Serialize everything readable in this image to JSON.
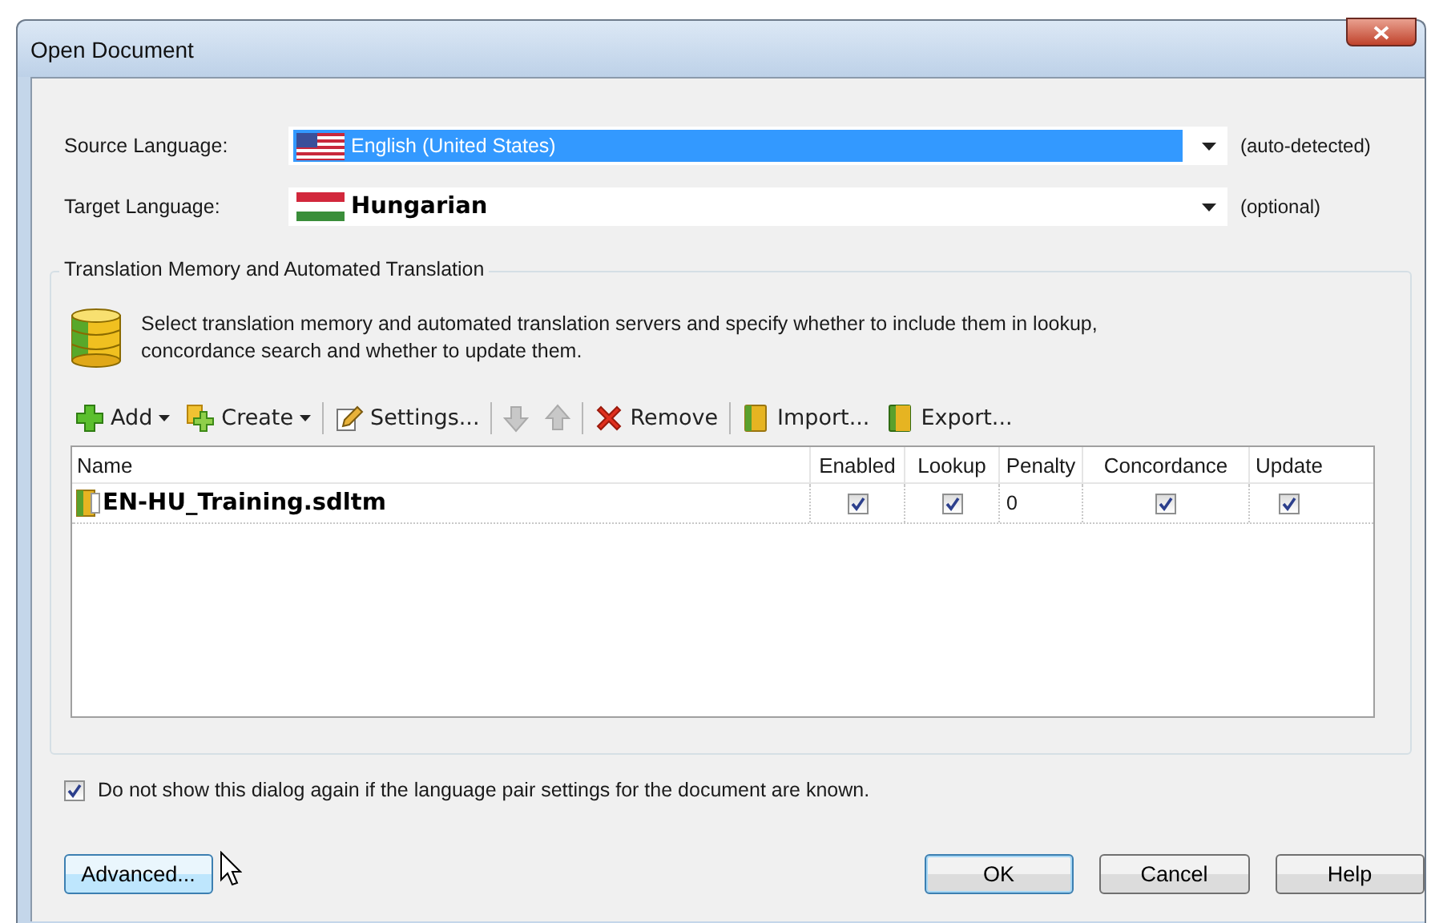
{
  "window": {
    "title": "Open Document"
  },
  "languages": [
    {
      "label": "Source Language:",
      "value": "English (United States)",
      "selected": true,
      "note": "(auto-detected)"
    },
    {
      "label": "Target Language:",
      "value": "Hungarian",
      "selected": false,
      "note": "(optional)"
    }
  ],
  "group": {
    "title": "Translation Memory and Automated Translation",
    "description": "Select translation memory and automated translation servers and specify whether to include them in lookup, concordance search and whether to update them.",
    "toolbar": [
      {
        "kind": "add",
        "label": "Add",
        "disabled": false
      },
      {
        "kind": "create",
        "label": "Create",
        "disabled": false
      },
      {
        "kind": "separator"
      },
      {
        "kind": "settings",
        "label": "Settings...",
        "disabled": false
      },
      {
        "kind": "separator"
      },
      {
        "kind": "down",
        "disabled": true
      },
      {
        "kind": "up",
        "disabled": true
      },
      {
        "kind": "separator"
      },
      {
        "kind": "remove",
        "label": "Remove",
        "disabled": false
      },
      {
        "kind": "separator"
      },
      {
        "kind": "import",
        "label": "Import...",
        "disabled": false
      },
      {
        "kind": "export",
        "label": "Export...",
        "disabled": false
      }
    ],
    "table": {
      "columns": [
        "Name",
        "Enabled",
        "Lookup",
        "Penalty",
        "Concordance",
        "Update"
      ],
      "rows": [
        {
          "name": "EN-HU_Training.sdltm",
          "enabled": true,
          "lookup": true,
          "penalty": "0",
          "concordance": true,
          "update": true
        }
      ]
    }
  },
  "dont_show_again": {
    "label": "Do not show this dialog again if the language pair settings for the document are known.",
    "checked": true
  },
  "buttons": [
    {
      "kind": "advanced",
      "label": "Advanced..."
    },
    {
      "kind": "ok",
      "label": "OK"
    },
    {
      "kind": "cancel",
      "label": "Cancel"
    },
    {
      "kind": "help",
      "label": "Help"
    }
  ]
}
